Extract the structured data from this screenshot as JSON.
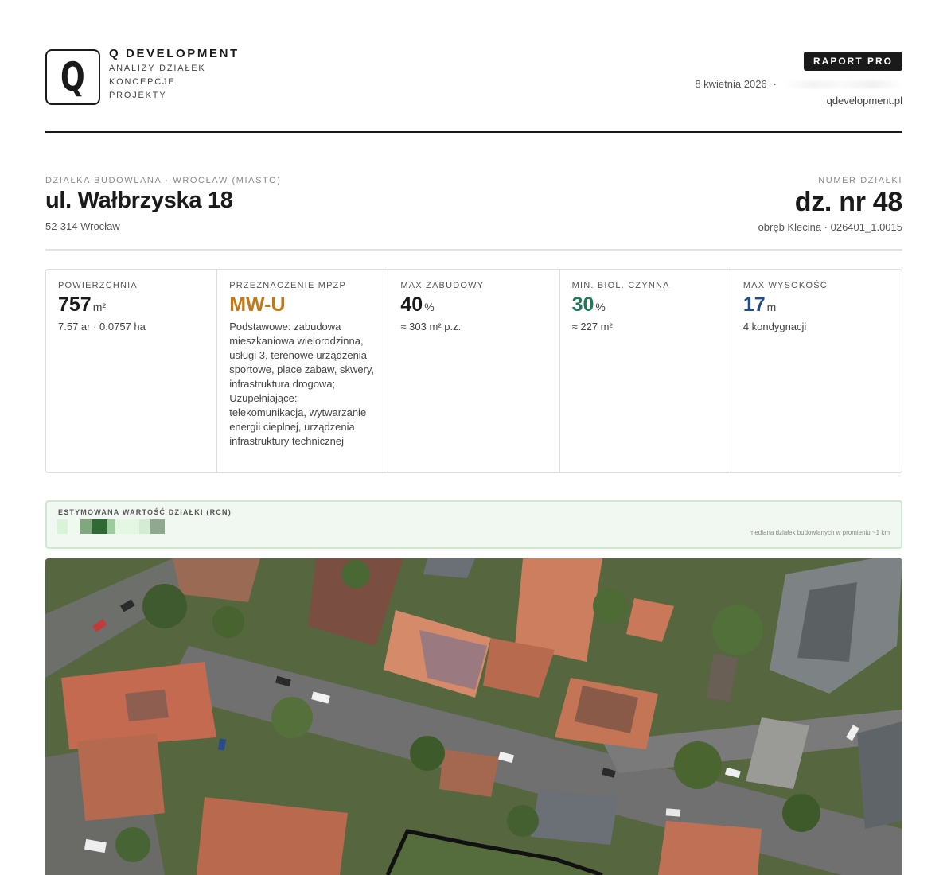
{
  "header": {
    "logo_letter": "Q",
    "brand_name": "Q DEVELOPMENT",
    "brand_lines": [
      "ANALIZY DZIAŁEK",
      "KONCEPCJE",
      "PROJEKTY"
    ],
    "badge": "RAPORT PRO",
    "date": "8 kwietnia 2026",
    "separator": "·",
    "website": "qdevelopment.pl"
  },
  "address": {
    "eyebrow": "DZIAŁKA BUDOWLANA · WROCŁAW (MIASTO)",
    "street": "ul. Wałbrzyska 18",
    "postal": "52-314 Wrocław"
  },
  "plot": {
    "eyebrow": "NUMER DZIAŁKI",
    "number": "dz. nr 48",
    "precinct": "obręb Klecina · 026401_1.0015"
  },
  "stats": [
    {
      "label": "POWIERZCHNIA",
      "value": "757",
      "unit": "m²",
      "detail": "7.57 ar · 0.0757 ha",
      "color": "#1a1a1a"
    },
    {
      "label": "PRZEZNACZENIE MPZP",
      "value": "MW-U",
      "unit": "",
      "detail": "Podstawowe: zabudowa mieszkaniowa wielorodzinna, usługi 3, terenowe urządzenia sportowe, place zabaw, skwery, infrastruktura drogowa; Uzupełniające: telekomunikacja, wytwarzanie energii cieplnej, urządzenia infrastruktury technicznej",
      "color": "#c07a1a"
    },
    {
      "label": "MAX ZABUDOWY",
      "value": "40",
      "unit": "%",
      "detail": "≈ 303 m² p.z.",
      "color": "#1a1a1a"
    },
    {
      "label": "MIN. BIOL. CZYNNA",
      "value": "30",
      "unit": "%",
      "detail": "≈ 227 m²",
      "color": "#1f7a5a"
    },
    {
      "label": "MAX WYSOKOŚĆ",
      "value": "17",
      "unit": "m",
      "detail": "4 kondygnacji",
      "color": "#1f4d8a"
    }
  ],
  "estimate": {
    "label": "ESTYMOWANA WARTOŚĆ DZIAŁKI (RCN)",
    "note": "mediana działek budowlanych w promieniu ~1 km"
  },
  "map": {
    "image": "aerial-photo"
  }
}
